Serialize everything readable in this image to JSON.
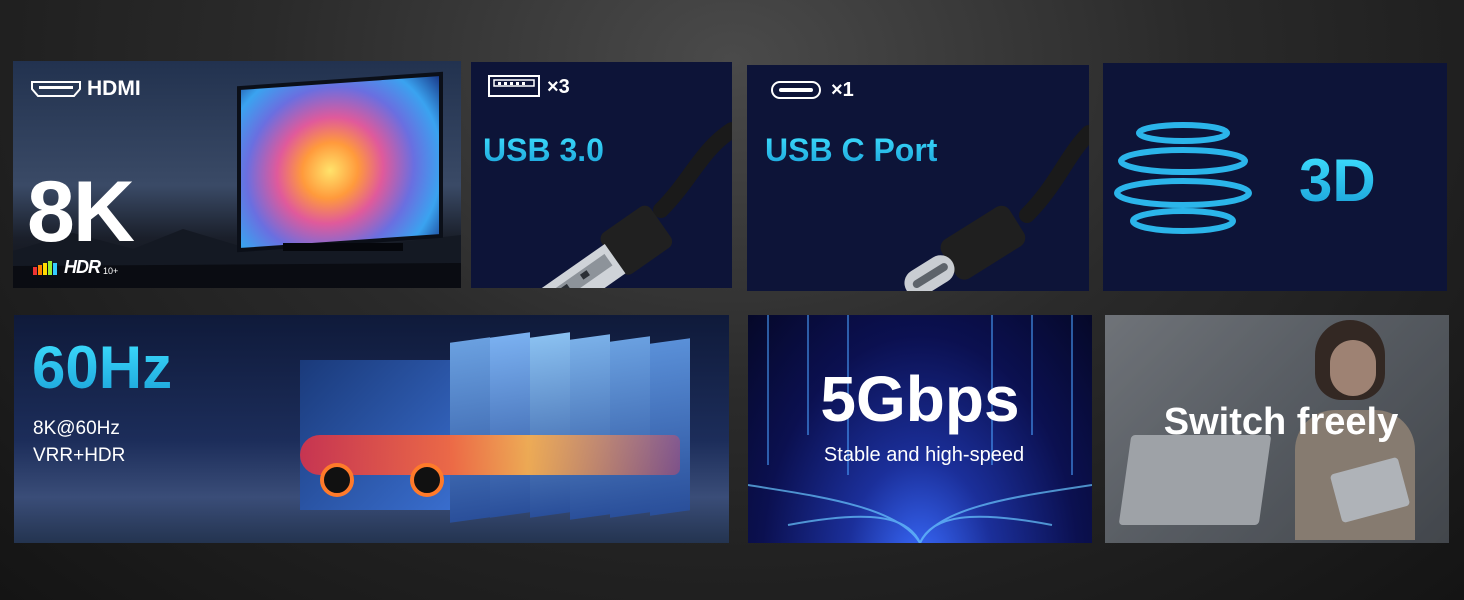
{
  "hdmi_tile": {
    "port_label": "HDMI",
    "resolution": "8K",
    "hdr_badge": "HDR",
    "hdr_suffix": "10+"
  },
  "usb3_tile": {
    "count": "×3",
    "title": "USB 3.0"
  },
  "usbc_tile": {
    "count": "×1",
    "title": "USB C Port"
  },
  "three_d_tile": {
    "title": "3D"
  },
  "refresh_tile": {
    "title": "60Hz",
    "line1": "8K@60Hz",
    "line2": "VRR+HDR"
  },
  "speed_tile": {
    "title": "5Gbps",
    "subtitle": "Stable and high-speed"
  },
  "switch_tile": {
    "title": "Switch freely"
  },
  "colors": {
    "accent_cyan": "#2cc6f0",
    "tile_navy": "#0d1438"
  }
}
